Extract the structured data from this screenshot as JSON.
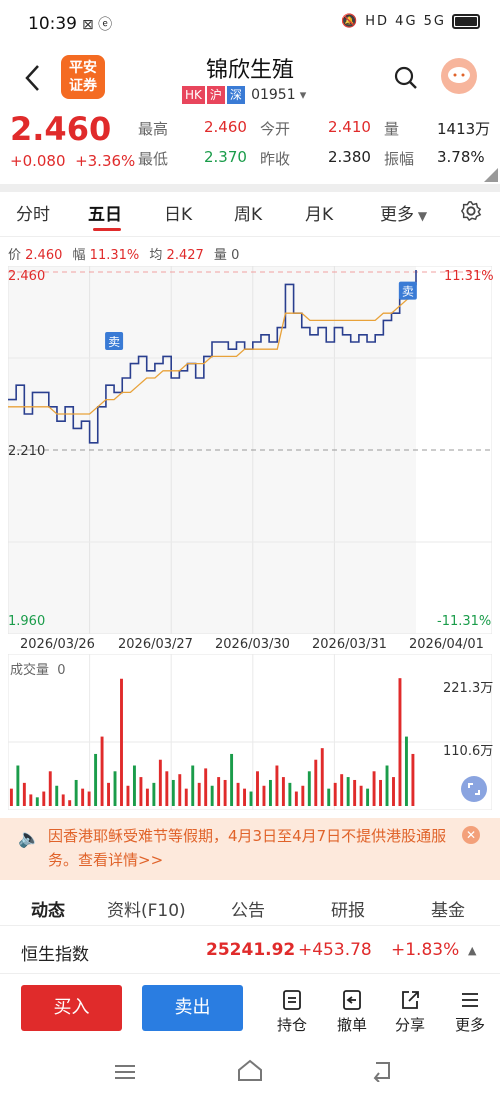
{
  "status_bar": {
    "time": "10:39",
    "left_icons": "⊠ ⓔ",
    "right_icons": "🔕 HD 4G 5G"
  },
  "header": {
    "title": "锦欣生殖",
    "logo_line1": "平安",
    "logo_line2": "证券",
    "tags": [
      "HK",
      "沪",
      "深"
    ],
    "code": "01951"
  },
  "quote": {
    "price": "2.460",
    "change": "+0.080",
    "change_pct": "+3.36%",
    "high_label": "最高",
    "high": "2.460",
    "low_label": "最低",
    "low": "2.370",
    "open_label": "今开",
    "open": "2.410",
    "prev_close_label": "昨收",
    "prev_close": "2.380",
    "volume_label": "量",
    "volume": "1413万",
    "amplitude_label": "振幅",
    "amplitude": "3.78%"
  },
  "tabs": [
    "分时",
    "五日",
    "日K",
    "周K",
    "月K",
    "更多"
  ],
  "active_tab": "五日",
  "info_line": {
    "price_label": "价",
    "price": "2.460",
    "range_label": "幅",
    "range": "11.31%",
    "avg_label": "均",
    "avg": "2.427",
    "vol_label": "量",
    "vol": "0"
  },
  "chart_data": {
    "type": "line",
    "title": "",
    "ylim": [
      1.96,
      2.46
    ],
    "y_tick_labels": [
      "2.460",
      "2.210",
      "1.960"
    ],
    "pct_labels": [
      "11.31%",
      "-11.31%"
    ],
    "x_tick_labels": [
      "2026/03/26",
      "2026/03/27",
      "2026/03/30",
      "2026/03/31",
      "2026/04/01"
    ],
    "price_series": [
      2.28,
      2.3,
      2.26,
      2.29,
      2.29,
      2.27,
      2.25,
      2.27,
      2.24,
      2.25,
      2.22,
      2.27,
      2.3,
      2.29,
      2.31,
      2.33,
      2.34,
      2.32,
      2.33,
      2.34,
      2.31,
      2.32,
      2.33,
      2.31,
      2.34,
      2.36,
      2.36,
      2.35,
      2.36,
      2.35,
      2.36,
      2.37,
      2.36,
      2.38,
      2.44,
      2.4,
      2.38,
      2.37,
      2.38,
      2.36,
      2.38,
      2.37,
      2.36,
      2.37,
      2.36,
      2.37,
      2.39,
      2.4,
      2.42,
      2.44,
      2.46
    ],
    "avg_series": [
      2.27,
      2.27,
      2.27,
      2.27,
      2.27,
      2.27,
      2.26,
      2.26,
      2.26,
      2.26,
      2.26,
      2.27,
      2.28,
      2.28,
      2.29,
      2.29,
      2.3,
      2.31,
      2.31,
      2.32,
      2.32,
      2.32,
      2.33,
      2.33,
      2.33,
      2.34,
      2.34,
      2.34,
      2.34,
      2.35,
      2.35,
      2.35,
      2.35,
      2.35,
      2.4,
      2.4,
      2.4,
      2.39,
      2.39,
      2.39,
      2.39,
      2.39,
      2.39,
      2.39,
      2.39,
      2.39,
      2.4,
      2.4,
      2.41,
      2.42,
      2.43
    ],
    "sell_markers": [
      {
        "label": "卖",
        "price": 2.36
      },
      {
        "label": "卖",
        "price": 2.43
      }
    ],
    "volume_label": "成交量",
    "volume_value": "0",
    "volume_ticks": [
      "221.3万",
      "110.6万"
    ],
    "volume_max": 221.3,
    "volume_series": [
      30,
      70,
      40,
      20,
      15,
      25,
      60,
      35,
      20,
      10,
      45,
      30,
      25,
      90,
      120,
      40,
      60,
      220,
      35,
      70,
      50,
      30,
      40,
      80,
      60,
      45,
      55,
      30,
      70,
      40,
      65,
      35,
      50,
      45,
      90,
      40,
      30,
      25,
      60,
      35,
      45,
      70,
      50,
      40,
      25,
      35,
      60,
      80,
      100,
      30,
      40,
      55,
      50,
      45,
      35,
      30,
      60,
      45,
      70,
      50,
      221,
      120,
      90
    ]
  },
  "notice": {
    "text": "因香港耶稣受难节等假期，4月3日至4月7日不提供港股通服务。查看详情>>"
  },
  "bottom_tabs": [
    "动态",
    "资料(F10)",
    "公告",
    "研报",
    "基金"
  ],
  "index_row": {
    "name": "恒生指数",
    "value": "25241.92",
    "change": "+453.78",
    "pct": "+1.83%"
  },
  "actions": {
    "buy": "买入",
    "sell": "卖出",
    "position": "持仓",
    "cancel": "撤单",
    "share": "分享",
    "more": "更多"
  },
  "colors": {
    "up": "#e02b2b",
    "down": "#1a9c4a",
    "price_line": "#2a3f8f",
    "avg_line": "#e8a23a",
    "notice_bg": "#fde9dc"
  }
}
